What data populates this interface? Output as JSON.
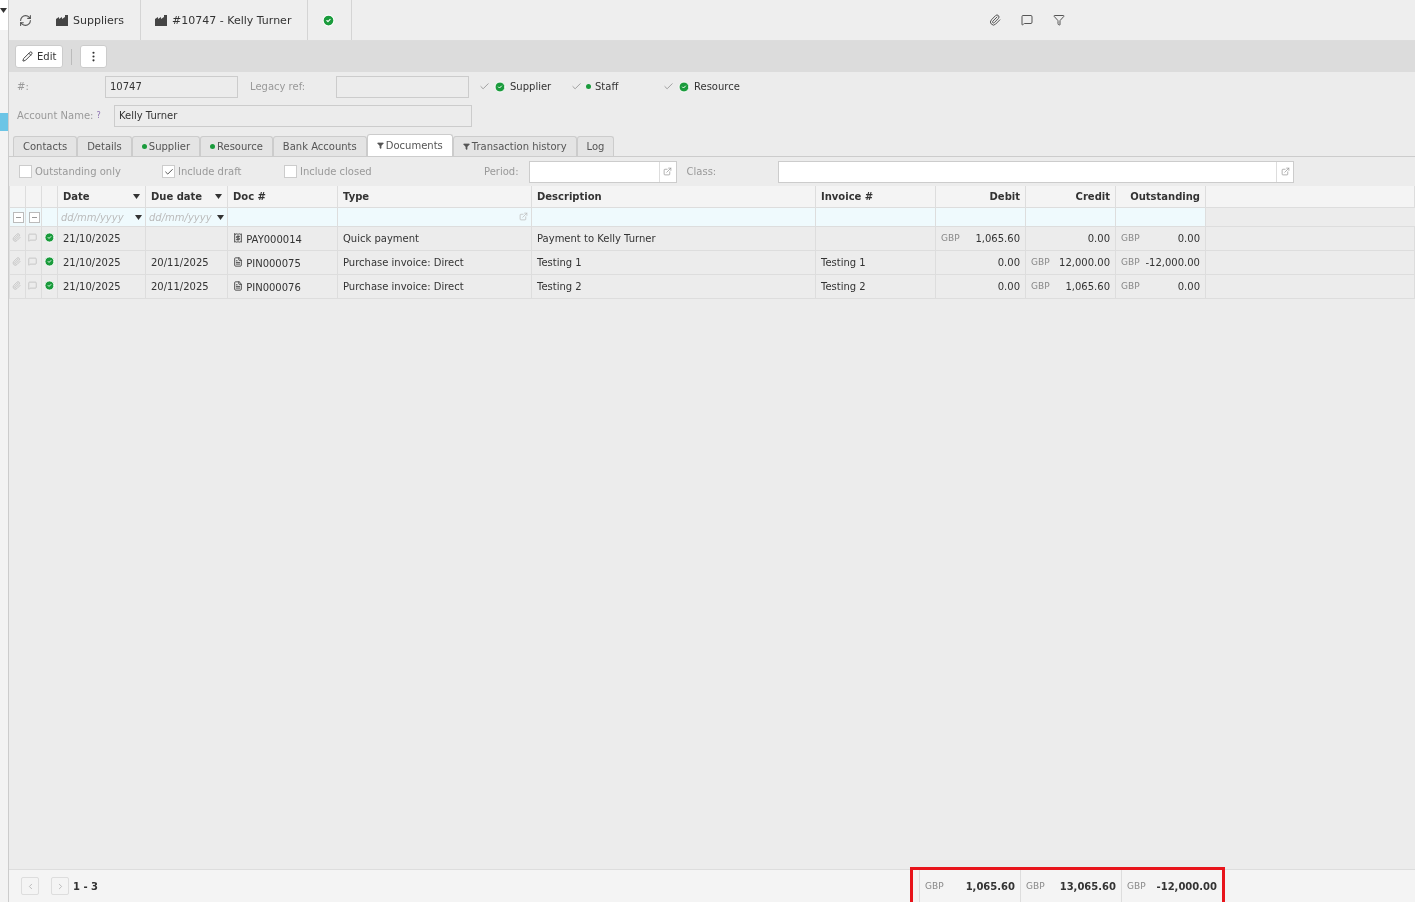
{
  "breadcrumbs": [
    {
      "label": "Suppliers"
    },
    {
      "label": "#10747 - Kelly Turner"
    }
  ],
  "toolbar": {
    "edit": "Edit"
  },
  "fields": {
    "number": {
      "label": "#:",
      "value": "10747"
    },
    "legacy": {
      "label": "Legacy ref:"
    },
    "account": {
      "label": "Account Name:",
      "hint": "?",
      "value": "Kelly Turner"
    }
  },
  "roles": [
    {
      "label": "Supplier",
      "checked": true,
      "kind": "check"
    },
    {
      "label": "Staff",
      "checked": true,
      "kind": "dot"
    },
    {
      "label": "Resource",
      "checked": true,
      "kind": "check"
    }
  ],
  "tabs": [
    {
      "label": "Contacts",
      "selected": false,
      "dot": false,
      "filtered": false
    },
    {
      "label": "Details",
      "selected": false,
      "dot": false,
      "filtered": false
    },
    {
      "label": "Supplier",
      "selected": false,
      "dot": true,
      "filtered": false
    },
    {
      "label": "Resource",
      "selected": false,
      "dot": true,
      "filtered": false
    },
    {
      "label": "Bank Accounts",
      "selected": false,
      "dot": false,
      "filtered": false
    },
    {
      "label": "Documents",
      "selected": true,
      "dot": false,
      "filtered": true
    },
    {
      "label": "Transaction history",
      "selected": false,
      "dot": false,
      "filtered": true
    },
    {
      "label": "Log",
      "selected": false,
      "dot": false,
      "filtered": false
    }
  ],
  "filters": [
    {
      "label": "Outstanding only",
      "checked": false
    },
    {
      "label": "Include draft",
      "checked": true
    },
    {
      "label": "Include closed",
      "checked": false
    }
  ],
  "period": {
    "label": "Period:"
  },
  "class": {
    "label": "Class:"
  },
  "table": {
    "columns": [
      "Date",
      "Due date",
      "Doc #",
      "Type",
      "Description",
      "Invoice #",
      "Debit",
      "Credit",
      "Outstanding"
    ],
    "date_filters": [
      {
        "placeholder": "dd/mm/yyyy"
      },
      {
        "placeholder": "dd/mm/yyyy"
      }
    ],
    "rows": [
      {
        "date": "21/10/2025",
        "due": "",
        "kind": "payment",
        "doc": "PAY000014",
        "type": "Quick payment",
        "description": "Payment to Kelly Turner",
        "invoice": "",
        "debit": {
          "currency": "GBP",
          "amount": "1,065.60"
        },
        "credit": {
          "amount": "0.00"
        },
        "outstanding": {
          "currency": "GBP",
          "amount": "0.00"
        }
      },
      {
        "date": "21/10/2025",
        "due": "20/11/2025",
        "kind": "invoice",
        "doc": "PIN000075",
        "type": "Purchase invoice: Direct",
        "description": "Testing 1",
        "invoice": "Testing 1",
        "debit": {
          "amount": "0.00"
        },
        "credit": {
          "currency": "GBP",
          "amount": "12,000.00"
        },
        "outstanding": {
          "currency": "GBP",
          "amount": "-12,000.00"
        }
      },
      {
        "date": "21/10/2025",
        "due": "20/11/2025",
        "kind": "invoice",
        "doc": "PIN000076",
        "type": "Purchase invoice: Direct",
        "description": "Testing 2",
        "invoice": "Testing 2",
        "debit": {
          "amount": "0.00"
        },
        "credit": {
          "currency": "GBP",
          "amount": "1,065.60"
        },
        "outstanding": {
          "currency": "GBP",
          "amount": "0.00"
        }
      }
    ]
  },
  "footer": {
    "range": "1 - 3",
    "highlighted": true,
    "totals": [
      {
        "currency": "GBP",
        "amount": "1,065.60"
      },
      {
        "currency": "GBP",
        "amount": "13,065.60"
      },
      {
        "currency": "GBP",
        "amount": "-12,000.00"
      }
    ]
  }
}
